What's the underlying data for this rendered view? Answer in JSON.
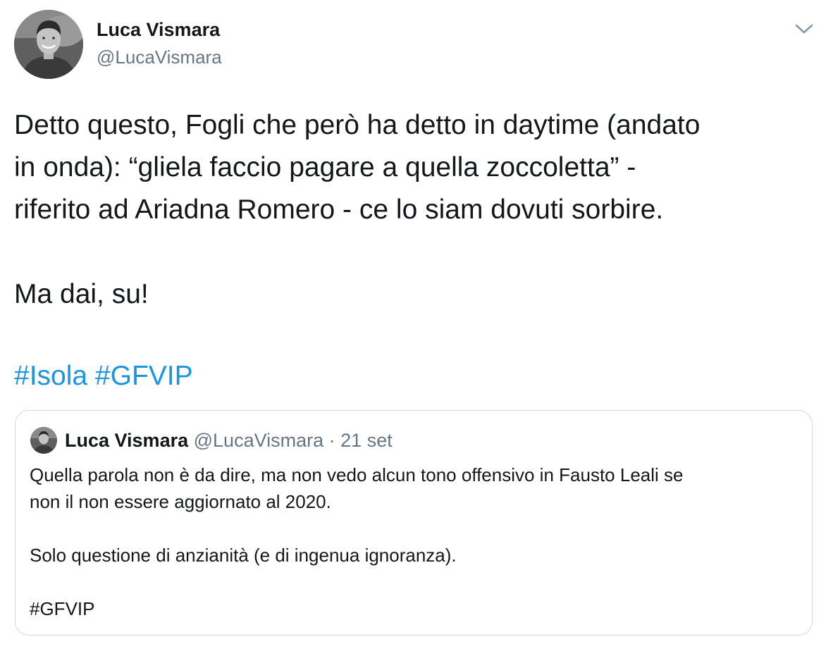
{
  "author": {
    "name": "Luca Vismara",
    "handle": "@LucaVismara"
  },
  "tweet": {
    "lines": [
      "Detto questo, Fogli che però ha detto in daytime (andato",
      "in onda): “gliela faccio pagare a quella zoccoletta” -",
      "riferito ad Ariadna Romero - ce lo siam dovuti sorbire.",
      "Ma dai, su!"
    ],
    "hashtags": [
      "#Isola",
      "#GFVIP"
    ]
  },
  "quoted_tweet": {
    "name": "Luca Vismara",
    "handle": "@LucaVismara",
    "separator": "·",
    "date": "21 set",
    "lines": [
      "Quella parola non è da dire, ma non vedo alcun tono offensivo in Fausto Leali se",
      "non il non essere aggiornato al 2020.",
      "Solo questione di anzianità (e di ingenua ignoranza).",
      "#GFVIP"
    ]
  },
  "icons": {
    "caret": "chevron-down-icon",
    "avatar": "avatar"
  },
  "colors": {
    "text": "#14171a",
    "secondary": "#657786",
    "link": "#1b95e0",
    "border": "#cfd9de"
  }
}
